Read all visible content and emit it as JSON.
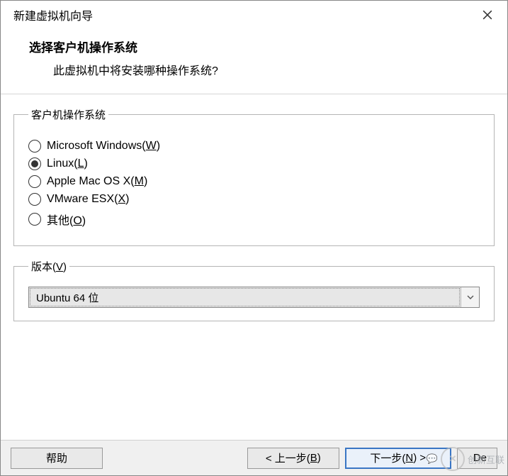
{
  "window": {
    "title": "新建虚拟机向导"
  },
  "header": {
    "title": "选择客户机操作系统",
    "subtitle": "此虚拟机中将安装哪种操作系统?"
  },
  "os_group": {
    "legend": "客户机操作系统",
    "options": [
      {
        "label": "Microsoft Windows(",
        "accel": "W",
        "tail": ")",
        "selected": false
      },
      {
        "label": "Linux(",
        "accel": "L",
        "tail": ")",
        "selected": true
      },
      {
        "label": "Apple Mac OS X(",
        "accel": "M",
        "tail": ")",
        "selected": false
      },
      {
        "label": "VMware ESX(",
        "accel": "X",
        "tail": ")",
        "selected": false
      },
      {
        "label": "其他(",
        "accel": "O",
        "tail": ")",
        "selected": false
      }
    ]
  },
  "version": {
    "legend_pre": "版本(",
    "legend_accel": "V",
    "legend_post": ")",
    "selected": "Ubuntu 64 位"
  },
  "footer": {
    "help": "帮助",
    "back_pre": "< 上一步(",
    "back_accel": "B",
    "back_post": ")",
    "next_pre": "下一步(",
    "next_accel": "N",
    "next_post": ") >",
    "cancel_visible_text": "De"
  },
  "watermark": {
    "wechat": "…",
    "brand": "创新互联"
  }
}
